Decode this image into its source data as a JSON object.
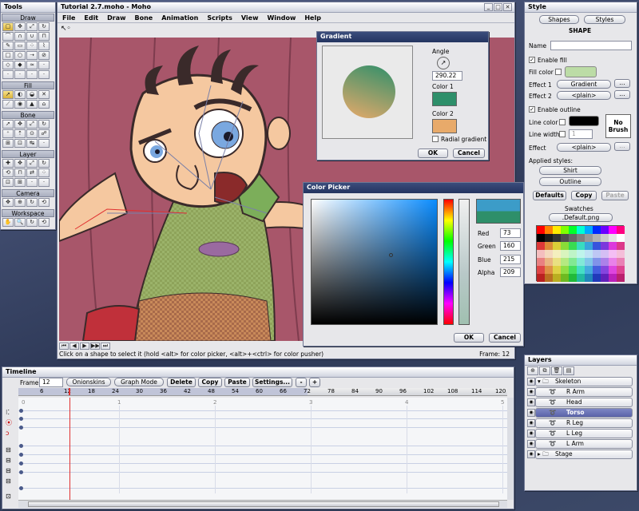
{
  "tools": {
    "title": "Tools",
    "sections": [
      "Draw",
      "Fill",
      "Bone",
      "Layer",
      "Camera",
      "Workspace"
    ]
  },
  "main": {
    "title": "Tutorial 2.7.moho - Moho",
    "menu": [
      "File",
      "Edit",
      "Draw",
      "Bone",
      "Animation",
      "Scripts",
      "View",
      "Window",
      "Help"
    ],
    "status": "Click on a shape to select it (hold <alt> for color picker, <alt>+<ctrl> for color pusher)",
    "frame_status": "Frame: 12"
  },
  "gradient": {
    "title": "Gradient",
    "angle_label": "Angle",
    "angle_value": "290.22",
    "color1_label": "Color 1",
    "color2_label": "Color 2",
    "radial_label": "Radial gradient",
    "ok": "OK",
    "cancel": "Cancel",
    "color1": "#2e8f6a",
    "color2": "#e8aa6a"
  },
  "picker": {
    "title": "Color Picker",
    "red_label": "Red",
    "red": "73",
    "green_label": "Green",
    "green": "160",
    "blue_label": "Blue",
    "blue": "215",
    "alpha_label": "Alpha",
    "alpha": "209",
    "ok": "OK",
    "cancel": "Cancel"
  },
  "style": {
    "title": "Style",
    "shapes_btn": "Shapes",
    "styles_btn": "Styles",
    "heading": "SHAPE",
    "name_label": "Name",
    "name_value": "",
    "enable_fill": "Enable fill",
    "fill_color_label": "Fill color",
    "effect1_label": "Effect 1",
    "effect1": "Gradient",
    "effect2_label": "Effect 2",
    "effect2": "<plain>",
    "enable_outline": "Enable outline",
    "line_color_label": "Line color",
    "line_width_label": "Line width",
    "line_width": "1",
    "no_brush": "No Brush",
    "effect_label": "Effect",
    "effect": "<plain>",
    "applied_label": "Applied styles:",
    "applied1": "Shirt",
    "applied2": "Outline",
    "defaults": "Defaults",
    "copy": "Copy",
    "paste": "Paste",
    "swatches_label": "Swatches",
    "swatches_file": ".Default.png",
    "ellipsis": "...",
    "fill_color": "#bcdca6",
    "line_color": "#000000"
  },
  "timeline": {
    "title": "Timeline",
    "frame_label": "Frame",
    "frame_value": "12",
    "onionskins": "Onionskins",
    "graph_mode": "Graph Mode",
    "delete": "Delete",
    "copy": "Copy",
    "paste": "Paste",
    "settings": "Settings...",
    "minus": "-",
    "plus": "+",
    "ruler": [
      "6",
      "12",
      "18",
      "24",
      "30",
      "36",
      "42",
      "48",
      "54",
      "60",
      "66",
      "72",
      "78",
      "84",
      "90",
      "96",
      "102",
      "108",
      "114",
      "120"
    ],
    "row_marks": [
      "1",
      "2",
      "3",
      "4",
      "5"
    ],
    "zero": "0"
  },
  "layers": {
    "title": "Layers",
    "items": [
      {
        "name": "Skeleton",
        "indent": 0,
        "kind": "group-open"
      },
      {
        "name": "R Arm",
        "indent": 1,
        "kind": "layer"
      },
      {
        "name": "Head",
        "indent": 1,
        "kind": "layer"
      },
      {
        "name": "Torso",
        "indent": 1,
        "kind": "layer",
        "selected": true
      },
      {
        "name": "R Leg",
        "indent": 1,
        "kind": "layer"
      },
      {
        "name": "L Leg",
        "indent": 1,
        "kind": "layer"
      },
      {
        "name": "L Arm",
        "indent": 1,
        "kind": "layer"
      },
      {
        "name": "Stage",
        "indent": 0,
        "kind": "group-closed"
      }
    ]
  }
}
